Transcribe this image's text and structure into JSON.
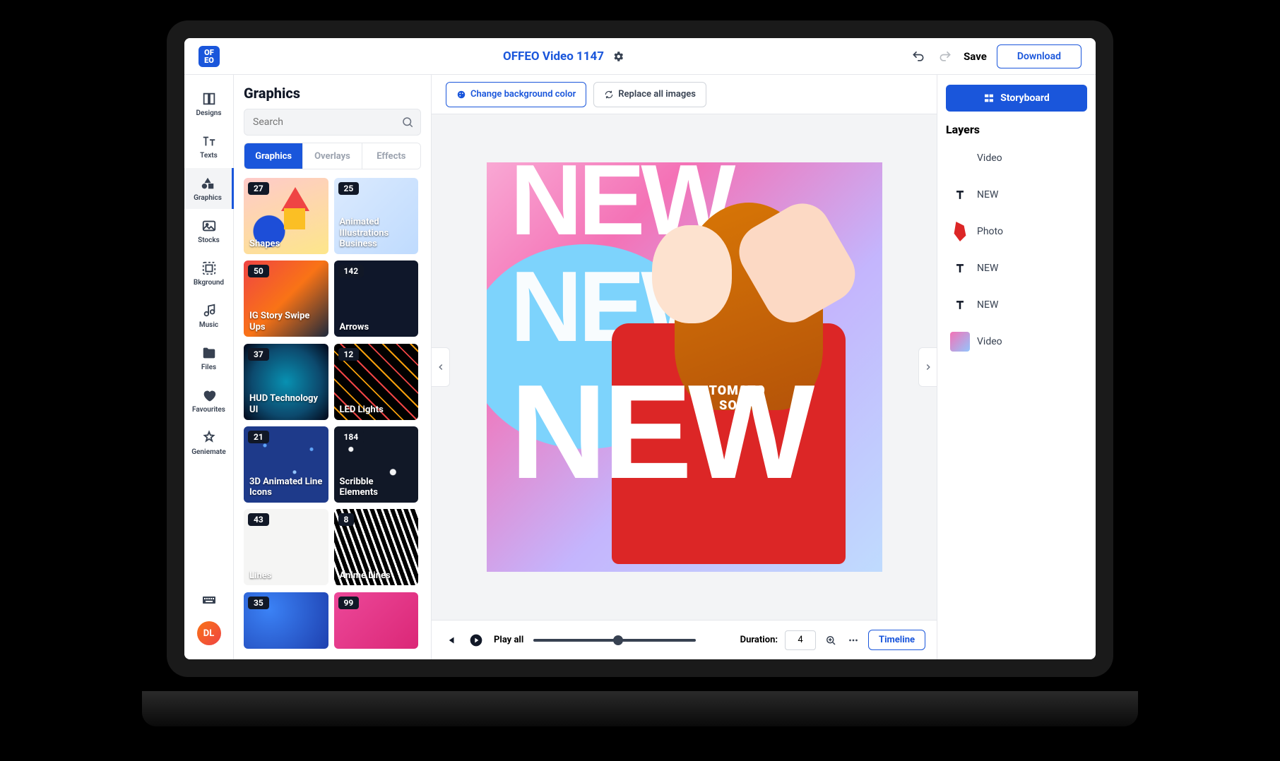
{
  "topbar": {
    "project_title": "OFFEO Video 1147",
    "save_label": "Save",
    "download_label": "Download"
  },
  "rail": {
    "items": [
      {
        "label": "Designs"
      },
      {
        "label": "Texts"
      },
      {
        "label": "Graphics"
      },
      {
        "label": "Stocks"
      },
      {
        "label": "Bkground"
      },
      {
        "label": "Music"
      },
      {
        "label": "Files"
      },
      {
        "label": "Favourites"
      },
      {
        "label": "Geniemate"
      }
    ],
    "avatar": "DL"
  },
  "panel": {
    "title": "Graphics",
    "search_placeholder": "Search",
    "tabs": [
      {
        "label": "Graphics",
        "active": true
      },
      {
        "label": "Overlays",
        "active": false
      },
      {
        "label": "Effects",
        "active": false
      }
    ],
    "cards": [
      {
        "count": "27",
        "label": "Shapes"
      },
      {
        "count": "25",
        "label": "Animated Illustrations Business"
      },
      {
        "count": "50",
        "label": "IG Story Swipe Ups"
      },
      {
        "count": "142",
        "label": "Arrows"
      },
      {
        "count": "37",
        "label": "HUD Technology UI"
      },
      {
        "count": "12",
        "label": "LED Lights"
      },
      {
        "count": "21",
        "label": "3D Animated Line Icons"
      },
      {
        "count": "184",
        "label": "Scribble Elements"
      },
      {
        "count": "43",
        "label": "Lines"
      },
      {
        "count": "8",
        "label": "Anime Lines"
      },
      {
        "count": "35",
        "label": ""
      },
      {
        "count": "99",
        "label": ""
      }
    ]
  },
  "canvas_toolbar": {
    "change_bg": "Change background color",
    "replace_images": "Replace all images"
  },
  "canvas": {
    "text1": "NEW",
    "text2": "NEW",
    "text3": "NEW",
    "shirt_text": "TOMATO",
    "shirt_sub": "SOUP"
  },
  "playbar": {
    "play_all": "Play all",
    "duration_label": "Duration:",
    "duration_value": "4",
    "timeline": "Timeline"
  },
  "right": {
    "storyboard": "Storyboard",
    "layers_title": "Layers",
    "layers": [
      {
        "label": "Video",
        "type": "video"
      },
      {
        "label": "NEW",
        "type": "text"
      },
      {
        "label": "Photo",
        "type": "photo"
      },
      {
        "label": "NEW",
        "type": "text"
      },
      {
        "label": "NEW",
        "type": "text"
      },
      {
        "label": "Video",
        "type": "video-grad"
      }
    ]
  }
}
